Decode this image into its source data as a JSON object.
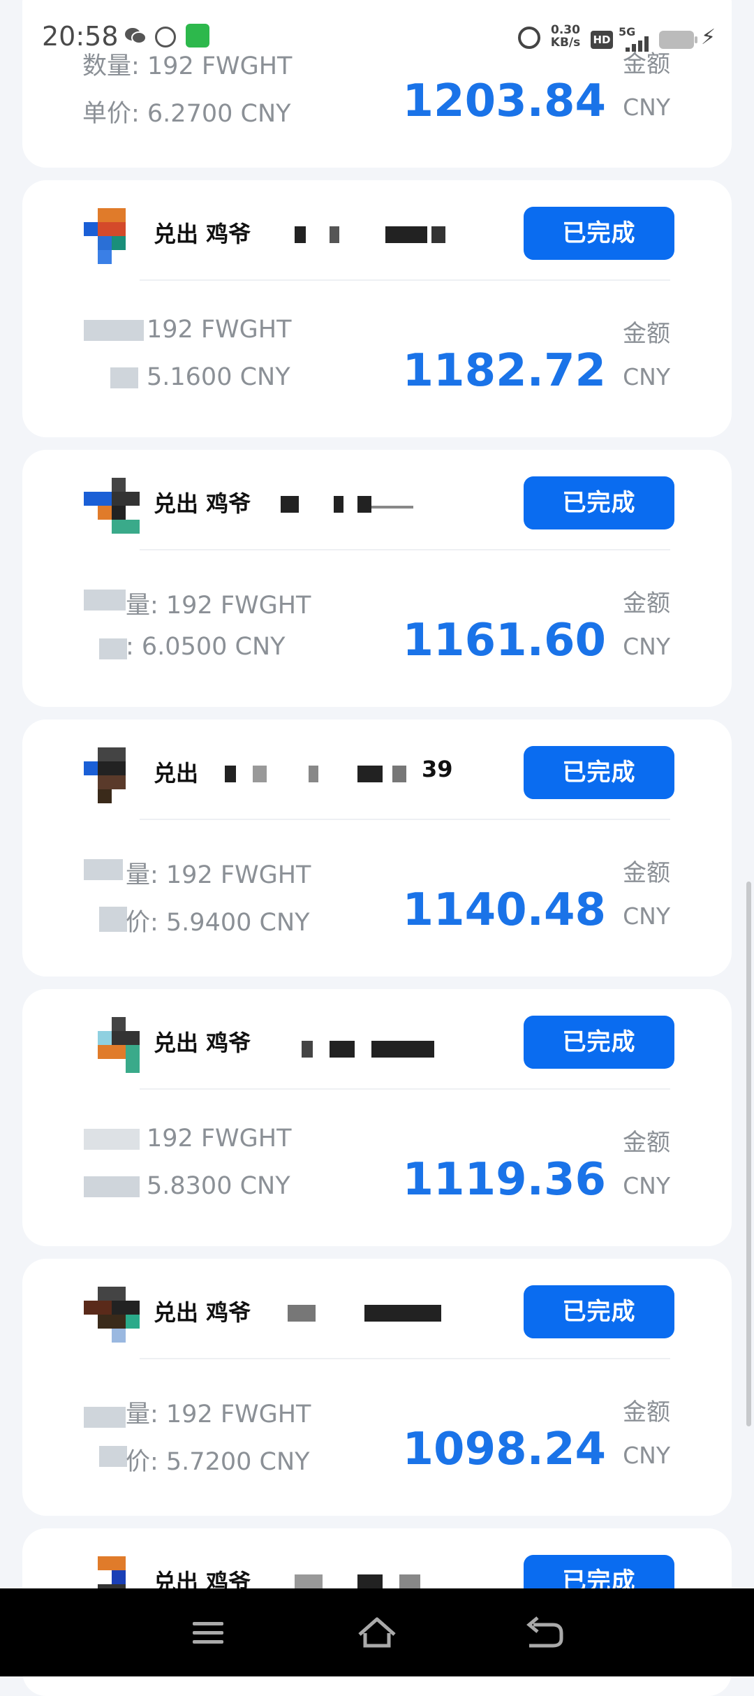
{
  "status_bar": {
    "time": "20:58",
    "net_speed_value": "0.30",
    "net_speed_unit": "KB/s",
    "hd": "HD",
    "network": "5G",
    "icons": [
      "wechat-icon",
      "weibo-icon",
      "app-icon",
      "alarm-icon",
      "signal-icon",
      "battery-icon",
      "charging-icon"
    ]
  },
  "labels": {
    "amount_label": "金额",
    "currency": "CNY",
    "status_done": "已完成"
  },
  "top_card": {
    "quantity": "数量: 192 FWGHT",
    "unit_price": "单价: 6.2700 CNY",
    "amount": "1203.84"
  },
  "orders": [
    {
      "title": "兑出 鸡爷",
      "quantity": "192 FWGHT",
      "unit_price": "5.1600 CNY",
      "amount": "1182.72",
      "status": "已完成"
    },
    {
      "title": "兑出 鸡爷",
      "quantity": "量: 192 FWGHT",
      "unit_price": ": 6.0500 CNY",
      "amount": "1161.60",
      "status": "已完成"
    },
    {
      "title": "兑出",
      "title_suffix": "39",
      "quantity": "量: 192 FWGHT",
      "unit_price": "价: 5.9400 CNY",
      "amount": "1140.48",
      "status": "已完成"
    },
    {
      "title": "兑出 鸡爷",
      "quantity": "192 FWGHT",
      "unit_price": "5.8300 CNY",
      "amount": "1119.36",
      "status": "已完成"
    },
    {
      "title": "兑出 鸡爷",
      "quantity": "量: 192 FWGHT",
      "unit_price": "价: 5.7200 CNY",
      "amount": "1098.24",
      "status": "已完成"
    },
    {
      "title": "兑出 鸡爷",
      "status": "已完成"
    }
  ],
  "nav": {
    "items": [
      "menu-icon",
      "home-icon",
      "back-icon"
    ]
  }
}
